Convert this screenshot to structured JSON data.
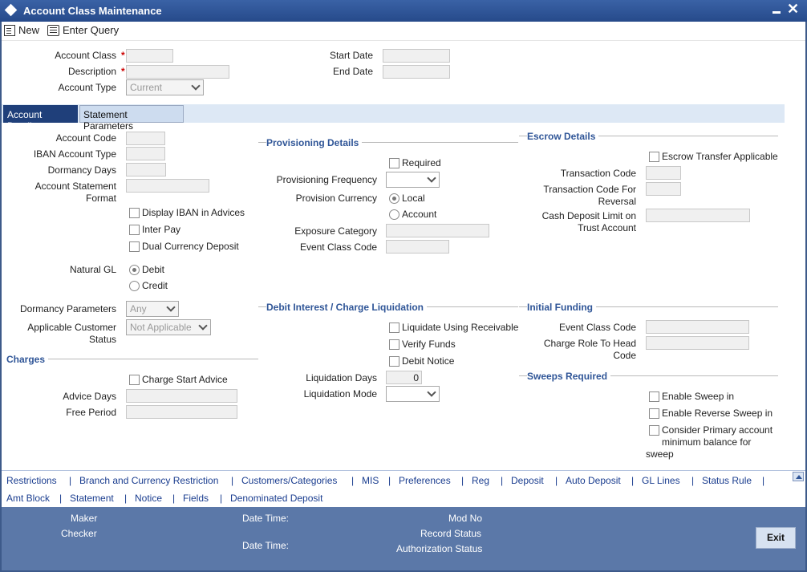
{
  "window": {
    "title": "Account Class Maintenance"
  },
  "toolbar": {
    "new_label": "New",
    "enter_query_label": "Enter Query"
  },
  "header": {
    "account_class_label": "Account Class",
    "description_label": "Description",
    "account_type_label": "Account Type",
    "account_type_value": "Current",
    "start_date_label": "Start Date",
    "end_date_label": "End Date",
    "required_marker": "*"
  },
  "tabs": [
    {
      "label": "Account Details",
      "active": true
    },
    {
      "label": "Statement Parameters",
      "active": false
    }
  ],
  "left": {
    "account_code_label": "Account Code",
    "iban_account_type_label": "IBAN Account Type",
    "dormancy_days_label": "Dormancy Days",
    "account_statement_format_label_1": "Account Statement",
    "account_statement_format_label_2": "Format",
    "display_iban_label": "Display IBAN in Advices",
    "inter_pay_label": "Inter Pay",
    "dual_currency_label": "Dual Currency Deposit",
    "natural_gl_label": "Natural GL",
    "debit_label": "Debit",
    "credit_label": "Credit",
    "dormancy_params_label": "Dormancy Parameters",
    "dormancy_params_value": "Any",
    "applicable_customer_status_label_1": "Applicable Customer",
    "applicable_customer_status_label_2": "Status",
    "applicable_customer_status_value": "Not Applicable"
  },
  "charges": {
    "section_label": "Charges",
    "charge_start_advice_label": "Charge Start Advice",
    "advice_days_label": "Advice Days",
    "free_period_label": "Free Period"
  },
  "provisioning": {
    "section_label": "Provisioning Details",
    "required_label": "Required",
    "frequency_label": "Provisioning Frequency",
    "currency_label": "Provision Currency",
    "local_label": "Local",
    "account_label": "Account",
    "exposure_category_label": "Exposure Category",
    "event_class_code_label": "Event Class Code"
  },
  "debit_interest": {
    "section_label": "Debit Interest / Charge Liquidation",
    "liquidate_label": "Liquidate Using Receivable",
    "verify_funds_label": "Verify Funds",
    "debit_notice_label": "Debit Notice",
    "liquidation_days_label": "Liquidation Days",
    "liquidation_days_value": "0",
    "liquidation_mode_label": "Liquidation Mode"
  },
  "escrow": {
    "section_label": "Escrow Details",
    "transfer_applicable_label": "Escrow Transfer Applicable",
    "transaction_code_label": "Transaction Code",
    "reversal_code_label_1": "Transaction Code For",
    "reversal_code_label_2": "Reversal",
    "cash_limit_label_1": "Cash Deposit Limit on",
    "cash_limit_label_2": "Trust Account"
  },
  "initial_funding": {
    "section_label": "Initial Funding",
    "event_class_code_label": "Event Class Code",
    "charge_role_label_1": "Charge Role To Head",
    "charge_role_label_2": "Code"
  },
  "sweeps": {
    "section_label": "Sweeps Required",
    "enable_sweep_in_label": "Enable Sweep in",
    "enable_reverse_label": "Enable Reverse Sweep in",
    "consider_primary_label_1": "Consider Primary account",
    "consider_primary_label_2": "minimum balance for",
    "consider_primary_label_3": "sweep"
  },
  "links_row1": [
    "Restrictions",
    "Branch and Currency Restriction",
    "Customers/Categories",
    "MIS",
    "Preferences",
    "Reg",
    "Deposit",
    "Auto Deposit",
    "GL Lines",
    "Status Rule"
  ],
  "links_row2": [
    "Amt Block",
    "Statement",
    "Notice",
    "Fields",
    "Denominated Deposit"
  ],
  "separator": "|",
  "footer": {
    "maker_label": "Maker",
    "checker_label": "Checker",
    "date_time_label": "Date Time:",
    "mod_no_label": "Mod No",
    "record_status_label": "Record Status",
    "authorization_status_label": "Authorization Status",
    "exit_label": "Exit"
  },
  "colors": {
    "title_bar": "#2f5597",
    "section_heading": "#2f5597",
    "active_tab": "#1f3f7a",
    "footer": "#5b78a8"
  }
}
